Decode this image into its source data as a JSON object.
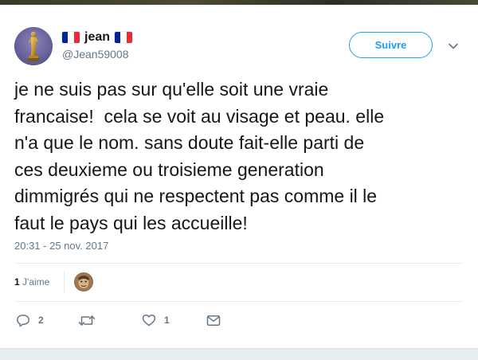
{
  "user": {
    "display_name": "jean",
    "handle": "@Jean59008"
  },
  "follow_button": {
    "label": "Suivre"
  },
  "tweet": {
    "text": "je ne suis pas sur qu'elle soit une vraie\nfrancaise!  cela se voit au visage et peau. elle\nn'a que le nom. sans doute fait-elle parti de\nces deuxieme ou troisieme generation\ndimmigrés qui ne respectent pas comme il le\nfaut le pays qui les accueille!",
    "timestamp": "20:31 - 25 nov. 2017"
  },
  "stats": {
    "likes_count": "1",
    "likes_label": "J'aime"
  },
  "actions": {
    "reply_count": "2",
    "retweet_count": "",
    "like_count": "1"
  },
  "colors": {
    "accent": "#1da1f2",
    "secondary_text": "#657786",
    "flag_blue": "#002395",
    "flag_red": "#ed2939"
  },
  "icons": [
    "trophy-avatar",
    "france-flag-icon",
    "chevron-down-icon",
    "reply-icon",
    "retweet-icon",
    "heart-icon",
    "envelope-icon"
  ]
}
